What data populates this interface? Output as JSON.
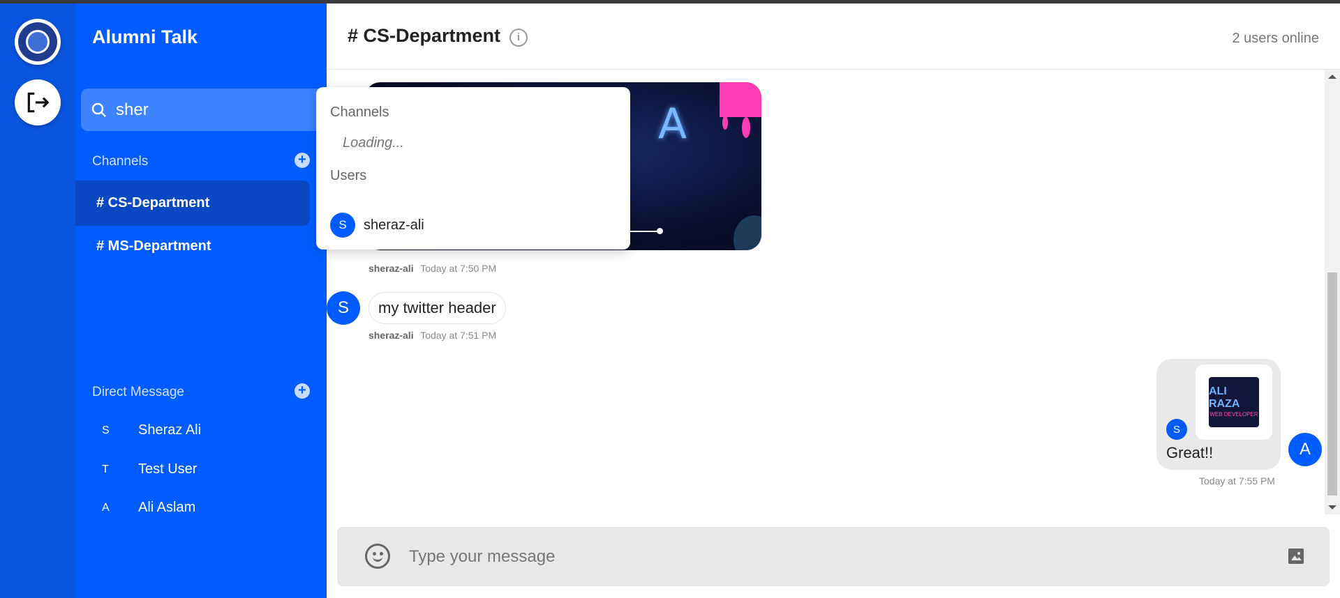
{
  "app": {
    "title": "Alumni Talk"
  },
  "rail": {
    "logo_icon": "university-logo-icon",
    "logout_icon": "logout-icon"
  },
  "search": {
    "value": "sher",
    "icon": "search-icon"
  },
  "channels": {
    "title": "Channels",
    "add_label": "+",
    "items": [
      {
        "label": "# CS-Department",
        "active": true
      },
      {
        "label": "# MS-Department",
        "active": false
      }
    ]
  },
  "direct": {
    "title": "Direct Message",
    "add_label": "+",
    "items": [
      {
        "letter": "S",
        "name": "Sheraz Ali"
      },
      {
        "letter": "T",
        "name": "Test User"
      },
      {
        "letter": "A",
        "name": "Ali Aslam"
      }
    ]
  },
  "header": {
    "channel": "# CS-Department",
    "info_icon": "info-icon",
    "info_label": "i",
    "online": "2 users online"
  },
  "messages": [
    {
      "type": "image",
      "user": "sheraz-ali",
      "time": "Today at 7:50 PM",
      "image_text": "A"
    },
    {
      "type": "text",
      "avatar": "S",
      "text": "my twitter header",
      "user": "sheraz-ali",
      "time": "Today at 7:51 PM"
    }
  ],
  "my_message": {
    "thumb_title": "ALI RAZA",
    "thumb_subtitle": "WEB DEVELOPER",
    "small_avatar": "S",
    "text": "Great!!",
    "avatar": "A",
    "time": "Today at 7:55 PM"
  },
  "composer": {
    "placeholder": "Type your message",
    "emoji_icon": "emoji-icon",
    "image_icon": "image-icon"
  },
  "dropdown": {
    "channels_title": "Channels",
    "loading": "Loading...",
    "users_title": "Users",
    "users": [
      {
        "letter": "S",
        "name": "sheraz-ali"
      }
    ]
  },
  "colors": {
    "primary": "#005cff",
    "rail": "#0a55df",
    "active_channel": "#0a47c2",
    "search_bg": "#3d82ff"
  }
}
